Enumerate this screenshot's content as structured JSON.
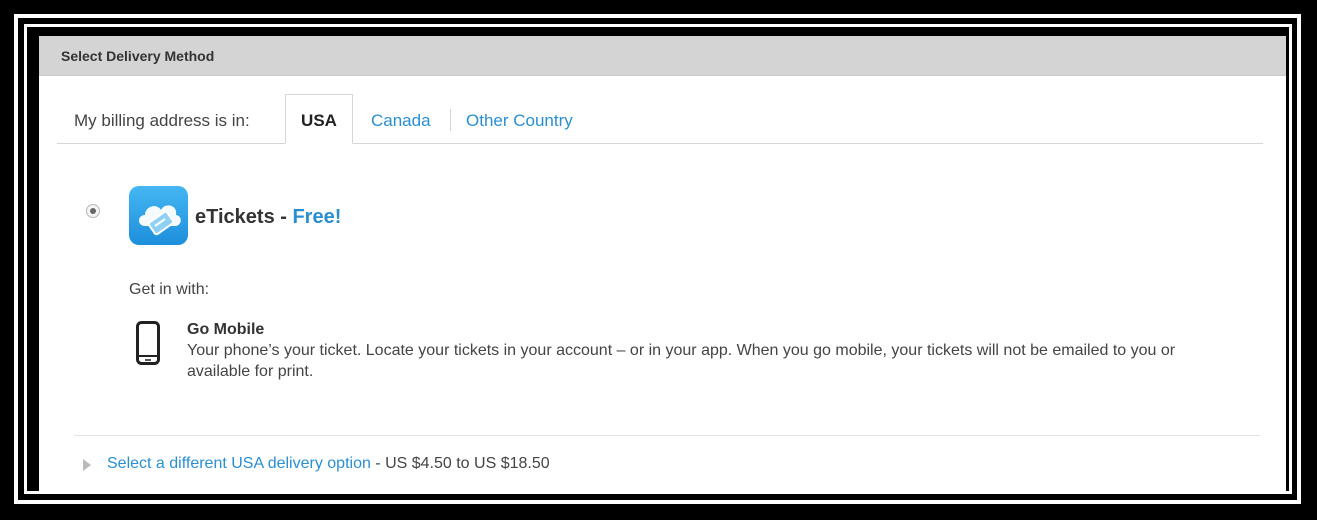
{
  "panel": {
    "title": "Select Delivery Method"
  },
  "billing": {
    "prompt": "My billing address is in:",
    "tabs": [
      {
        "label": "USA",
        "active": true
      },
      {
        "label": "Canada",
        "active": false
      },
      {
        "label": "Other Country",
        "active": false
      }
    ]
  },
  "option": {
    "selected": true,
    "icon": "cloud-ticket-app-icon",
    "name": "eTickets - ",
    "price": "Free!",
    "get_in_label": "Get in with:",
    "method": {
      "icon": "smartphone-icon",
      "title": "Go Mobile",
      "description": "Your phone’s your ticket. Locate your tickets in your account – or in your app. When you go mobile, your tickets will not be emailed to you or available for print."
    }
  },
  "other_option": {
    "link": "Select a different USA delivery option",
    "range": " - US $4.50 to US $18.50"
  },
  "colors": {
    "link": "#2a8fd1",
    "header_bg": "#d4d4d4",
    "icon_bg": "#2b9fe6"
  }
}
